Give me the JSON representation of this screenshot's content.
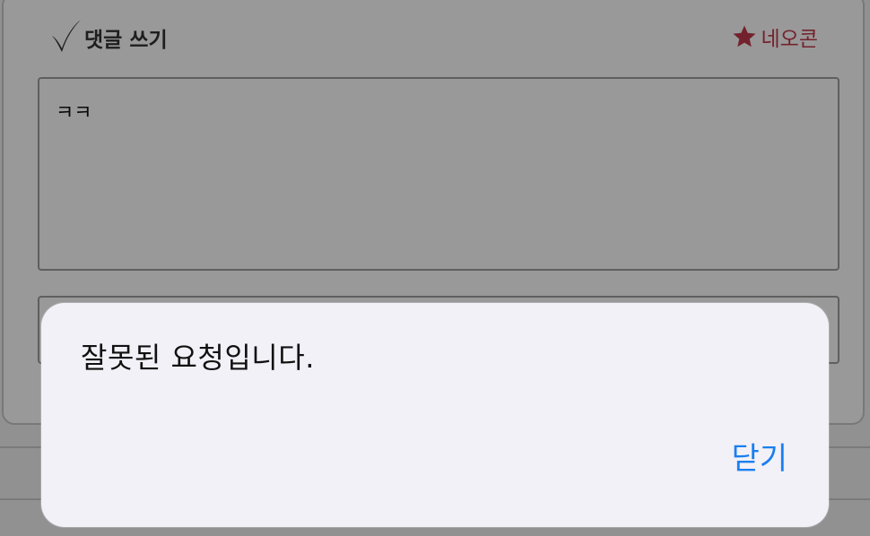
{
  "comment_form": {
    "title": "댓글 쓰기",
    "neocon_label": "네오콘",
    "comment_value": "ㅋㅋ",
    "check_icon": "checkmark-icon",
    "star_icon": "star-icon",
    "neocon_color": "#c0394b"
  },
  "alert": {
    "message": "잘못된 요청입니다.",
    "close_label": "닫기",
    "close_color": "#1a7ff0"
  }
}
